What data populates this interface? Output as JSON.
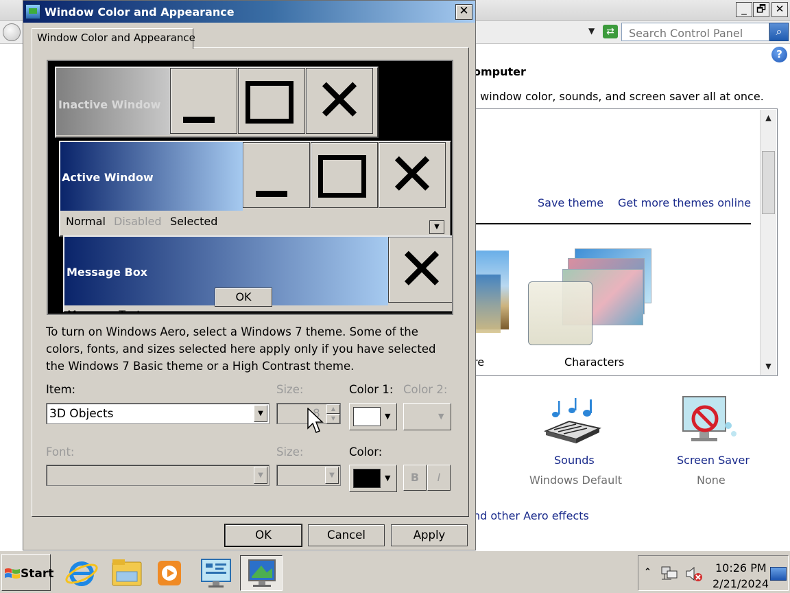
{
  "background_window": {
    "search": {
      "placeholder": "Search Control Panel"
    },
    "heading_partial": "omputer",
    "description_partial": ", window color, sounds, and screen saver all at once.",
    "links": {
      "save_theme": "Save theme",
      "get_more_themes": "Get more themes online"
    },
    "themes": [
      {
        "label_partial": "re"
      },
      {
        "label": "Characters"
      }
    ],
    "features": [
      {
        "title": "Sounds",
        "subtitle": "Windows Default",
        "icon": "sounds-icon"
      },
      {
        "title": "Screen Saver",
        "subtitle": "None",
        "icon": "screen-saver-icon"
      }
    ],
    "aero_link_partial": "nd other Aero effects",
    "title_buttons": {
      "minimize": "_",
      "restore": "🗗",
      "close": "✕"
    }
  },
  "dialog": {
    "title": "Window Color and Appearance",
    "tab": "Window Color and Appearance",
    "preview": {
      "inactive_window": "Inactive Window",
      "active_window": "Active Window",
      "menu": {
        "normal": "Normal",
        "disabled": "Disabled",
        "selected": "Selected"
      },
      "message_box": "Message Box",
      "message_text_partial": "Message Text",
      "ok": "OK"
    },
    "info_text": "To turn on Windows Aero, select a Windows 7 theme.  Some of the colors, fonts, and sizes selected here apply only if you have selected the Windows 7 Basic theme or a High Contrast theme.",
    "item": {
      "label": "Item:",
      "value": "3D Objects"
    },
    "item_size": {
      "label": "Size:",
      "value": "8"
    },
    "color1": {
      "label": "Color 1:",
      "value": "#ffffff"
    },
    "color2": {
      "label": "Color 2:"
    },
    "font": {
      "label": "Font:",
      "value": ""
    },
    "font_size": {
      "label": "Size:",
      "value": ""
    },
    "font_color": {
      "label": "Color:",
      "value": "#000000"
    },
    "bold": "B",
    "italic": "I",
    "buttons": {
      "ok": "OK",
      "cancel": "Cancel",
      "apply": "Apply"
    }
  },
  "taskbar": {
    "start": "Start",
    "pinned": [
      "internet-explorer-icon",
      "file-explorer-icon",
      "media-player-icon",
      "control-panel-icon",
      "display-settings-icon"
    ],
    "clock": {
      "time": "10:26 PM",
      "date": "2/21/2024"
    }
  },
  "colors": {
    "active_caption": "#0a246a",
    "active_caption_gradient": "#a6caf0",
    "inactive_caption": "#808080",
    "face": "#d4d0c8",
    "link": "#1a2b8c"
  }
}
